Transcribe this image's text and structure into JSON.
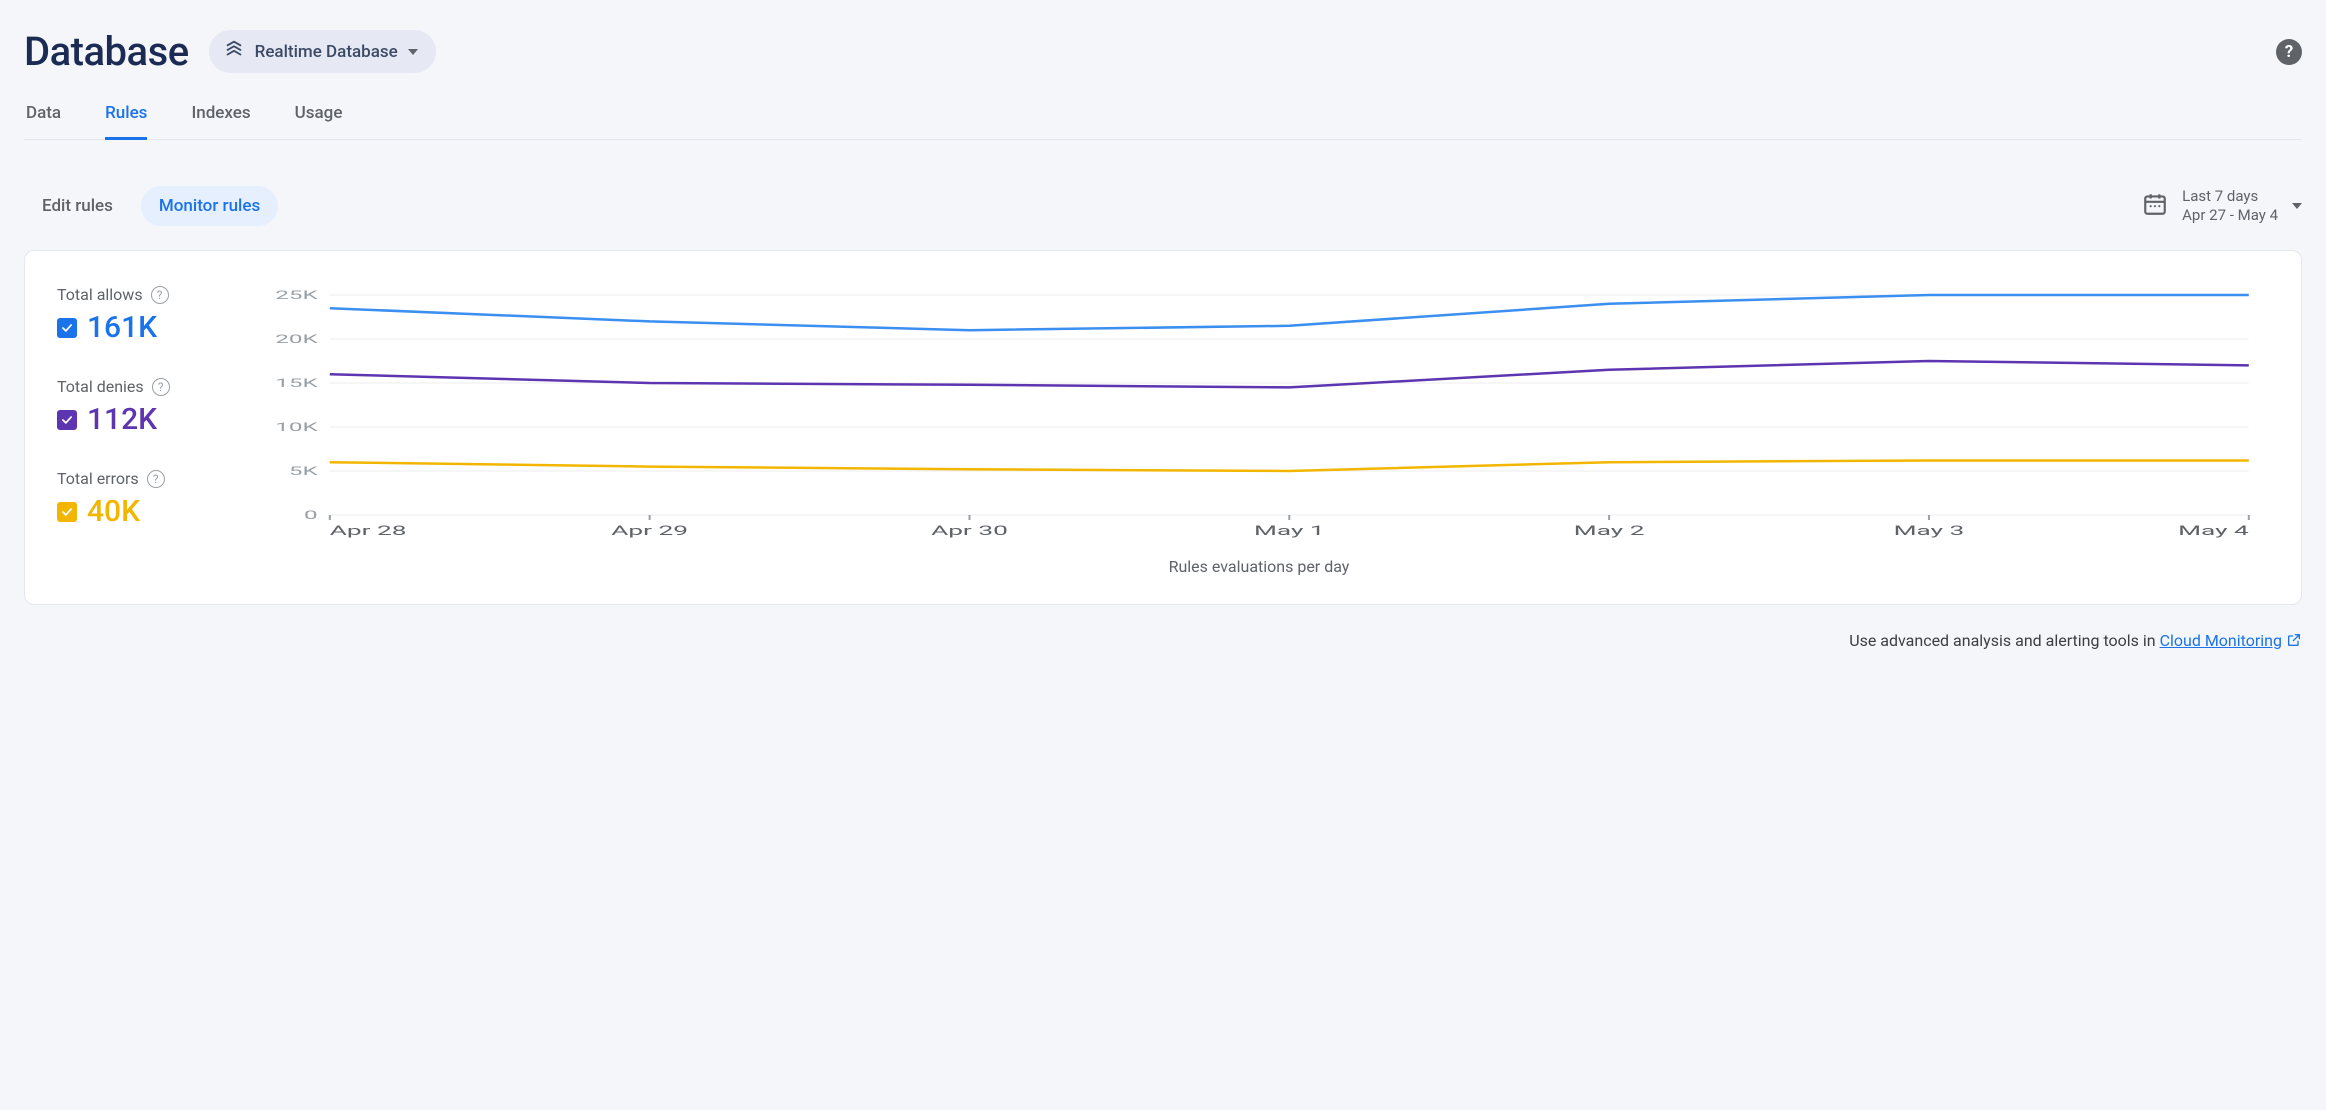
{
  "header": {
    "title": "Database",
    "product_selector": "Realtime Database"
  },
  "tabs": [
    {
      "label": "Data",
      "active": false
    },
    {
      "label": "Rules",
      "active": true
    },
    {
      "label": "Indexes",
      "active": false
    },
    {
      "label": "Usage",
      "active": false
    }
  ],
  "subtabs": [
    {
      "label": "Edit rules",
      "active": false
    },
    {
      "label": "Monitor rules",
      "active": true
    }
  ],
  "date_picker": {
    "range_label": "Last 7 days",
    "range_dates": "Apr 27 - May 4"
  },
  "metrics": [
    {
      "label": "Total allows",
      "value": "161K",
      "color": "#1a73e8"
    },
    {
      "label": "Total denies",
      "value": "112K",
      "color": "#5e35b1"
    },
    {
      "label": "Total errors",
      "value": "40K",
      "color": "#f2b600"
    }
  ],
  "chart_data": {
    "type": "line",
    "xlabel": "Rules evaluations per day",
    "ylabel": "",
    "ylim": [
      0,
      25000
    ],
    "y_ticks": [
      "0",
      "5K",
      "10K",
      "15K",
      "20K",
      "25K"
    ],
    "categories": [
      "Apr 28",
      "Apr 29",
      "Apr 30",
      "May 1",
      "May 2",
      "May 3",
      "May 4"
    ],
    "series": [
      {
        "name": "Total allows",
        "color": "#3b8ff0",
        "values": [
          23500,
          22000,
          21000,
          21500,
          24000,
          25000,
          25000
        ]
      },
      {
        "name": "Total denies",
        "color": "#5e35b1",
        "values": [
          16000,
          15000,
          14800,
          14500,
          16500,
          17500,
          17000
        ]
      },
      {
        "name": "Total errors",
        "color": "#f2b600",
        "values": [
          6000,
          5500,
          5200,
          5000,
          6000,
          6200,
          6200
        ]
      }
    ]
  },
  "footer": {
    "text_before": "Use advanced analysis and alerting tools in ",
    "link_text": "Cloud Monitoring"
  }
}
